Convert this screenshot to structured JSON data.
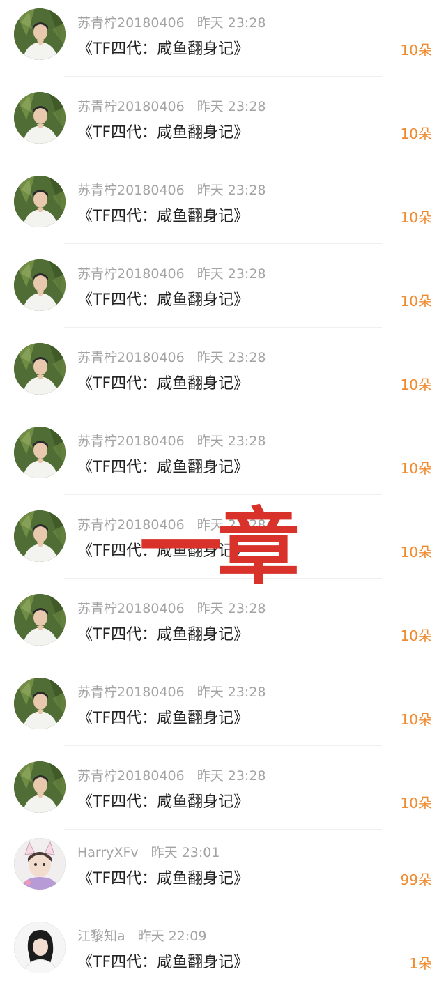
{
  "items": [
    {
      "name": "苏青柠20180406",
      "time": "昨天 23:28",
      "title": "《TF四代：咸鱼翻身记》",
      "count": "10朵",
      "avatar": "avatar-boy"
    },
    {
      "name": "苏青柠20180406",
      "time": "昨天 23:28",
      "title": "《TF四代：咸鱼翻身记》",
      "count": "10朵",
      "avatar": "avatar-boy"
    },
    {
      "name": "苏青柠20180406",
      "time": "昨天 23:28",
      "title": "《TF四代：咸鱼翻身记》",
      "count": "10朵",
      "avatar": "avatar-boy"
    },
    {
      "name": "苏青柠20180406",
      "time": "昨天 23:28",
      "title": "《TF四代：咸鱼翻身记》",
      "count": "10朵",
      "avatar": "avatar-boy"
    },
    {
      "name": "苏青柠20180406",
      "time": "昨天 23:28",
      "title": "《TF四代：咸鱼翻身记》",
      "count": "10朵",
      "avatar": "avatar-boy"
    },
    {
      "name": "苏青柠20180406",
      "time": "昨天 23:28",
      "title": "《TF四代：咸鱼翻身记》",
      "count": "10朵",
      "avatar": "avatar-boy"
    },
    {
      "name": "苏青柠20180406",
      "time": "昨天 23:28",
      "title": "《TF四代：咸鱼翻身记》",
      "count": "10朵",
      "avatar": "avatar-boy"
    },
    {
      "name": "苏青柠20180406",
      "time": "昨天 23:28",
      "title": "《TF四代：咸鱼翻身记》",
      "count": "10朵",
      "avatar": "avatar-boy"
    },
    {
      "name": "苏青柠20180406",
      "time": "昨天 23:28",
      "title": "《TF四代：咸鱼翻身记》",
      "count": "10朵",
      "avatar": "avatar-boy"
    },
    {
      "name": "苏青柠20180406",
      "time": "昨天 23:28",
      "title": "《TF四代：咸鱼翻身记》",
      "count": "10朵",
      "avatar": "avatar-boy"
    },
    {
      "name": "HarryXFv",
      "time": "昨天 23:01",
      "title": "《TF四代：咸鱼翻身记》",
      "count": "99朵",
      "avatar": "avatar-cat-ears"
    },
    {
      "name": "江黎知a",
      "time": "昨天 22:09",
      "title": "《TF四代：咸鱼翻身记》",
      "count": "1朵",
      "avatar": "avatar-girl"
    }
  ],
  "overlay": {
    "text": "一章",
    "color": "#d9322b"
  },
  "colors": {
    "name_time": "#a3a3a3",
    "title": "#222222",
    "count": "#f08a2e",
    "divider": "#efefef"
  }
}
